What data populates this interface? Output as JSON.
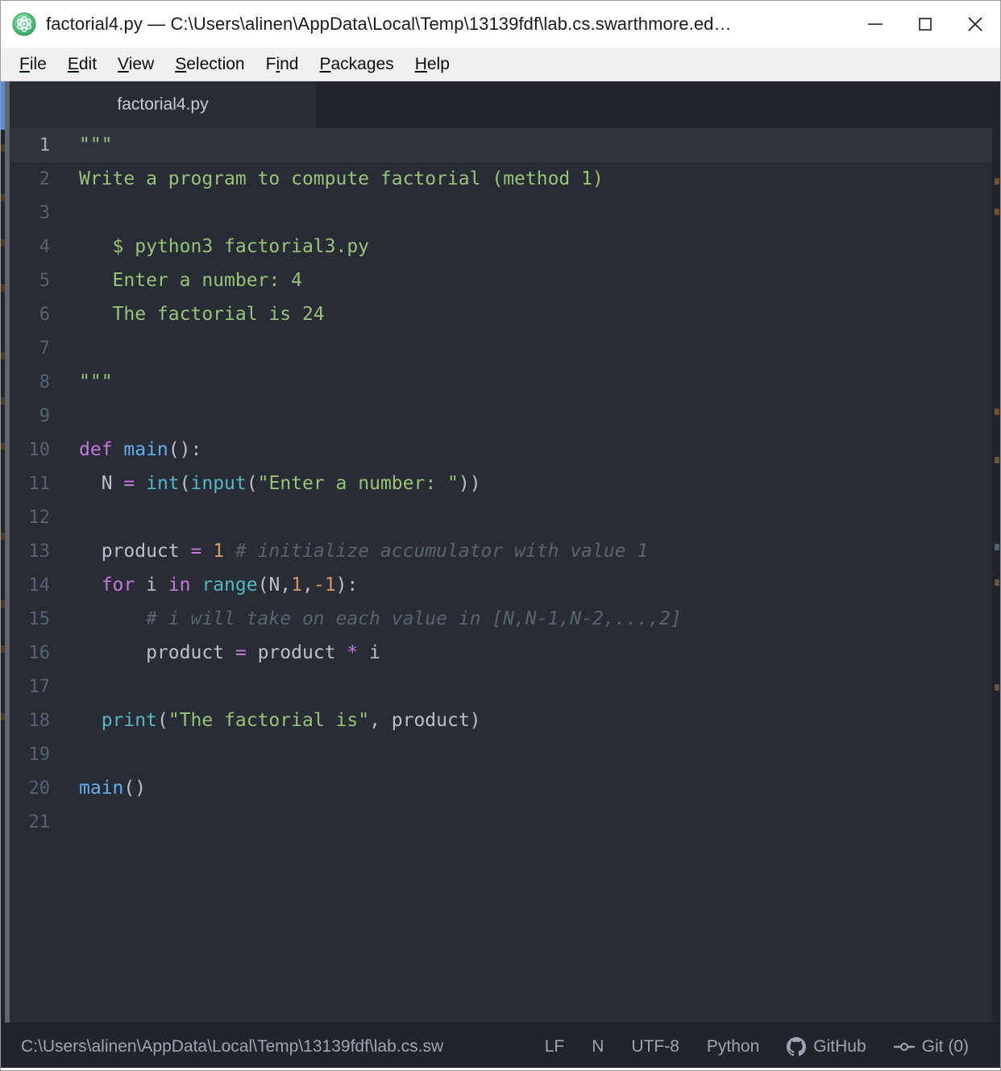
{
  "window": {
    "title": "factorial4.py — C:\\Users\\alinen\\AppData\\Local\\Temp\\13139fdf\\lab.cs.swarthmore.ed…",
    "app_icon": "atom-icon",
    "controls": {
      "minimize": "minimize-icon",
      "maximize": "maximize-icon",
      "close": "close-icon"
    }
  },
  "menubar": {
    "items": [
      {
        "label": "File",
        "pre": "",
        "accel": "F",
        "post": "ile"
      },
      {
        "label": "Edit",
        "pre": "",
        "accel": "E",
        "post": "dit"
      },
      {
        "label": "View",
        "pre": "",
        "accel": "V",
        "post": "iew"
      },
      {
        "label": "Selection",
        "pre": "",
        "accel": "S",
        "post": "election"
      },
      {
        "label": "Find",
        "pre": "F",
        "accel": "i",
        "post": "nd"
      },
      {
        "label": "Packages",
        "pre": "",
        "accel": "P",
        "post": "ackages"
      },
      {
        "label": "Help",
        "pre": "",
        "accel": "H",
        "post": "elp"
      }
    ]
  },
  "tabs": [
    {
      "label": "factorial4.py",
      "active": true
    }
  ],
  "editor": {
    "active_line": 1,
    "total_lines": 21,
    "colors": {
      "background": "#282c34",
      "active_line": "#2f343f",
      "gutter_text": "#5a6272",
      "string": "#98c379",
      "keyword": "#c678dd",
      "function": "#61afef",
      "builtin": "#56b6c2",
      "number": "#d19a66",
      "comment": "#5c6370",
      "text": "#b9c0cc"
    },
    "lines": [
      {
        "n": 1,
        "tokens": [
          {
            "t": "\"\"\"",
            "c": "str"
          }
        ]
      },
      {
        "n": 2,
        "tokens": [
          {
            "t": "Write a program to compute factorial (method 1)",
            "c": "str"
          }
        ]
      },
      {
        "n": 3,
        "tokens": []
      },
      {
        "n": 4,
        "tokens": [
          {
            "t": "   $ python3 factorial3.py",
            "c": "str"
          }
        ]
      },
      {
        "n": 5,
        "tokens": [
          {
            "t": "   Enter a number: 4",
            "c": "str"
          }
        ]
      },
      {
        "n": 6,
        "tokens": [
          {
            "t": "   The factorial is 24",
            "c": "str"
          }
        ]
      },
      {
        "n": 7,
        "tokens": []
      },
      {
        "n": 8,
        "tokens": [
          {
            "t": "\"\"\"",
            "c": "str"
          }
        ]
      },
      {
        "n": 9,
        "tokens": []
      },
      {
        "n": 10,
        "tokens": [
          {
            "t": "def ",
            "c": "kw"
          },
          {
            "t": "main",
            "c": "fn"
          },
          {
            "t": "():",
            "c": "punc"
          }
        ]
      },
      {
        "n": 11,
        "tokens": [
          {
            "t": "  N ",
            "c": "var"
          },
          {
            "t": "=",
            "c": "op"
          },
          {
            "t": " ",
            "c": "var"
          },
          {
            "t": "int",
            "c": "builtin"
          },
          {
            "t": "(",
            "c": "punc"
          },
          {
            "t": "input",
            "c": "builtin"
          },
          {
            "t": "(",
            "c": "punc"
          },
          {
            "t": "\"Enter a number: \"",
            "c": "str"
          },
          {
            "t": "))",
            "c": "punc"
          }
        ]
      },
      {
        "n": 12,
        "tokens": []
      },
      {
        "n": 13,
        "tokens": [
          {
            "t": "  product ",
            "c": "var"
          },
          {
            "t": "=",
            "c": "op"
          },
          {
            "t": " ",
            "c": "var"
          },
          {
            "t": "1",
            "c": "num"
          },
          {
            "t": " ",
            "c": "var"
          },
          {
            "t": "# initialize accumulator with value 1",
            "c": "cmt"
          }
        ]
      },
      {
        "n": 14,
        "tokens": [
          {
            "t": "  for ",
            "c": "kw"
          },
          {
            "t": "i ",
            "c": "var"
          },
          {
            "t": "in ",
            "c": "kw"
          },
          {
            "t": "range",
            "c": "builtin"
          },
          {
            "t": "(N,",
            "c": "punc"
          },
          {
            "t": "1",
            "c": "num"
          },
          {
            "t": ",",
            "c": "punc"
          },
          {
            "t": "-1",
            "c": "num"
          },
          {
            "t": "):",
            "c": "punc"
          }
        ]
      },
      {
        "n": 15,
        "tokens": [
          {
            "t": "      # i will take on each value in [N,N-1,N-2,...,2]",
            "c": "cmt"
          }
        ]
      },
      {
        "n": 16,
        "tokens": [
          {
            "t": "      product ",
            "c": "var"
          },
          {
            "t": "=",
            "c": "op"
          },
          {
            "t": " product ",
            "c": "var"
          },
          {
            "t": "*",
            "c": "op"
          },
          {
            "t": " i",
            "c": "var"
          }
        ]
      },
      {
        "n": 17,
        "tokens": []
      },
      {
        "n": 18,
        "tokens": [
          {
            "t": "  ",
            "c": "var"
          },
          {
            "t": "print",
            "c": "builtin"
          },
          {
            "t": "(",
            "c": "punc"
          },
          {
            "t": "\"The factorial is\"",
            "c": "str"
          },
          {
            "t": ", product)",
            "c": "punc"
          }
        ]
      },
      {
        "n": 19,
        "tokens": []
      },
      {
        "n": 20,
        "tokens": [
          {
            "t": "main",
            "c": "fn"
          },
          {
            "t": "()",
            "c": "punc"
          }
        ]
      },
      {
        "n": 21,
        "tokens": []
      }
    ]
  },
  "statusbar": {
    "path": "C:\\Users\\alinen\\AppData\\Local\\Temp\\13139fdf\\lab.cs.sw",
    "line_ending": "LF",
    "encoding_mode": "N",
    "encoding": "UTF-8",
    "grammar": "Python",
    "github": {
      "label": "GitHub",
      "icon": "github-icon"
    },
    "git": {
      "label": "Git (0)",
      "icon": "git-branch-icon"
    }
  }
}
